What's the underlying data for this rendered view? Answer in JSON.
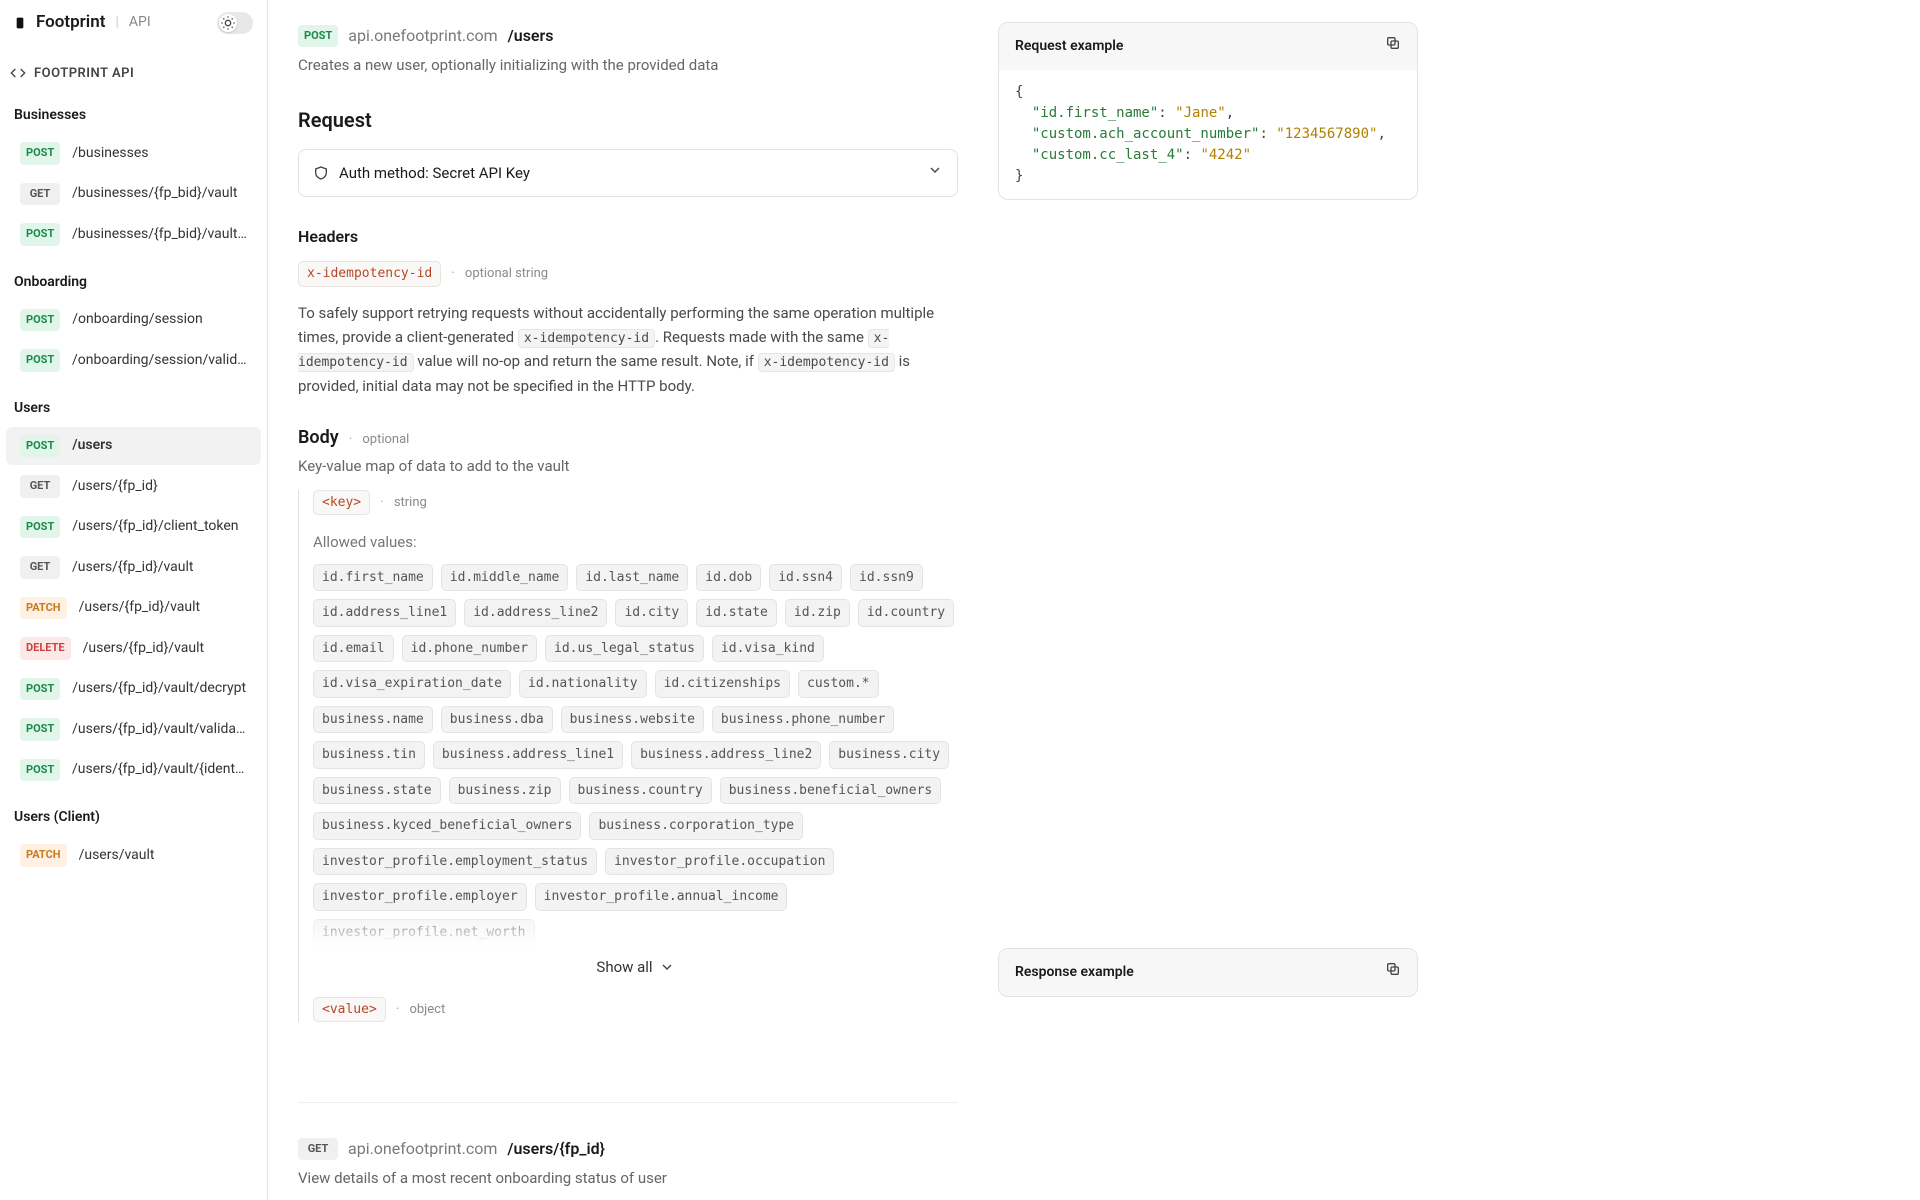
{
  "brand": {
    "name": "Footprint",
    "api_label": "API"
  },
  "nav_title": "FOOTPRINT API",
  "nav": [
    {
      "type": "section",
      "label": "Businesses"
    },
    {
      "type": "item",
      "method": "POST",
      "path": "/businesses"
    },
    {
      "type": "item",
      "method": "GET",
      "path": "/businesses/{fp_bid}/vault"
    },
    {
      "type": "item",
      "method": "POST",
      "path": "/businesses/{fp_bid}/vault/..."
    },
    {
      "type": "section",
      "label": "Onboarding"
    },
    {
      "type": "item",
      "method": "POST",
      "path": "/onboarding/session"
    },
    {
      "type": "item",
      "method": "POST",
      "path": "/onboarding/session/validate"
    },
    {
      "type": "section",
      "label": "Users"
    },
    {
      "type": "item",
      "method": "POST",
      "path": "/users",
      "active": true
    },
    {
      "type": "item",
      "method": "GET",
      "path": "/users/{fp_id}"
    },
    {
      "type": "item",
      "method": "POST",
      "path": "/users/{fp_id}/client_token"
    },
    {
      "type": "item",
      "method": "GET",
      "path": "/users/{fp_id}/vault"
    },
    {
      "type": "item",
      "method": "PATCH",
      "path": "/users/{fp_id}/vault"
    },
    {
      "type": "item",
      "method": "DELETE",
      "path": "/users/{fp_id}/vault"
    },
    {
      "type": "item",
      "method": "POST",
      "path": "/users/{fp_id}/vault/decrypt"
    },
    {
      "type": "item",
      "method": "POST",
      "path": "/users/{fp_id}/vault/validate"
    },
    {
      "type": "item",
      "method": "POST",
      "path": "/users/{fp_id}/vault/{identifi..."
    },
    {
      "type": "section",
      "label": "Users (Client)"
    },
    {
      "type": "item",
      "method": "PATCH",
      "path": "/users/vault"
    }
  ],
  "endpoint": {
    "method": "POST",
    "host": "api.onefootprint.com",
    "path": "/users",
    "description": "Creates a new user, optionally initializing with the provided data",
    "request_heading": "Request",
    "auth_label": "Auth method: Secret API Key",
    "headers_heading": "Headers",
    "header_param": {
      "name": "x-idempotency-id",
      "meta": "optional string",
      "desc_1": "To safely support retrying requests without accidentally performing the same operation multiple times, provide a client-generated ",
      "code_1": "x-idempotency-id",
      "desc_2": ". Requests made with the same ",
      "code_2": "x-idempotency-id",
      "desc_3": " value will no-op and return the same result. Note, if ",
      "code_3": "x-idempotency-id",
      "desc_4": " is provided, initial data may not be specified in the HTTP body."
    },
    "body_heading": "Body",
    "body_meta": "optional",
    "body_desc": "Key-value map of data to add to the vault",
    "key_name": "<key>",
    "key_meta": "string",
    "allowed_label": "Allowed values:",
    "allowed_values": [
      "id.first_name",
      "id.middle_name",
      "id.last_name",
      "id.dob",
      "id.ssn4",
      "id.ssn9",
      "id.address_line1",
      "id.address_line2",
      "id.city",
      "id.state",
      "id.zip",
      "id.country",
      "id.email",
      "id.phone_number",
      "id.us_legal_status",
      "id.visa_kind",
      "id.visa_expiration_date",
      "id.nationality",
      "id.citizenships",
      "custom.*",
      "business.name",
      "business.dba",
      "business.website",
      "business.phone_number",
      "business.tin",
      "business.address_line1",
      "business.address_line2",
      "business.city",
      "business.state",
      "business.zip",
      "business.country",
      "business.beneficial_owners",
      "business.kyced_beneficial_owners",
      "business.corporation_type",
      "investor_profile.employment_status",
      "investor_profile.occupation",
      "investor_profile.employer",
      "investor_profile.annual_income",
      "investor_profile.net_worth"
    ],
    "show_all": "Show all",
    "value_name": "<value>",
    "value_meta": "object"
  },
  "request_example": {
    "title": "Request example",
    "pairs": [
      {
        "k": "\"id.first_name\"",
        "v": "\"Jane\"",
        "trail": ","
      },
      {
        "k": "\"custom.ach_account_number\"",
        "v": "\"1234567890\"",
        "trail": ","
      },
      {
        "k": "\"custom.cc_last_4\"",
        "v": "\"4242\"",
        "trail": ""
      }
    ]
  },
  "endpoint2": {
    "method": "GET",
    "host": "api.onefootprint.com",
    "path": "/users/{fp_id}",
    "description": "View details of a most recent onboarding status of user"
  },
  "response_example_title": "Response example"
}
